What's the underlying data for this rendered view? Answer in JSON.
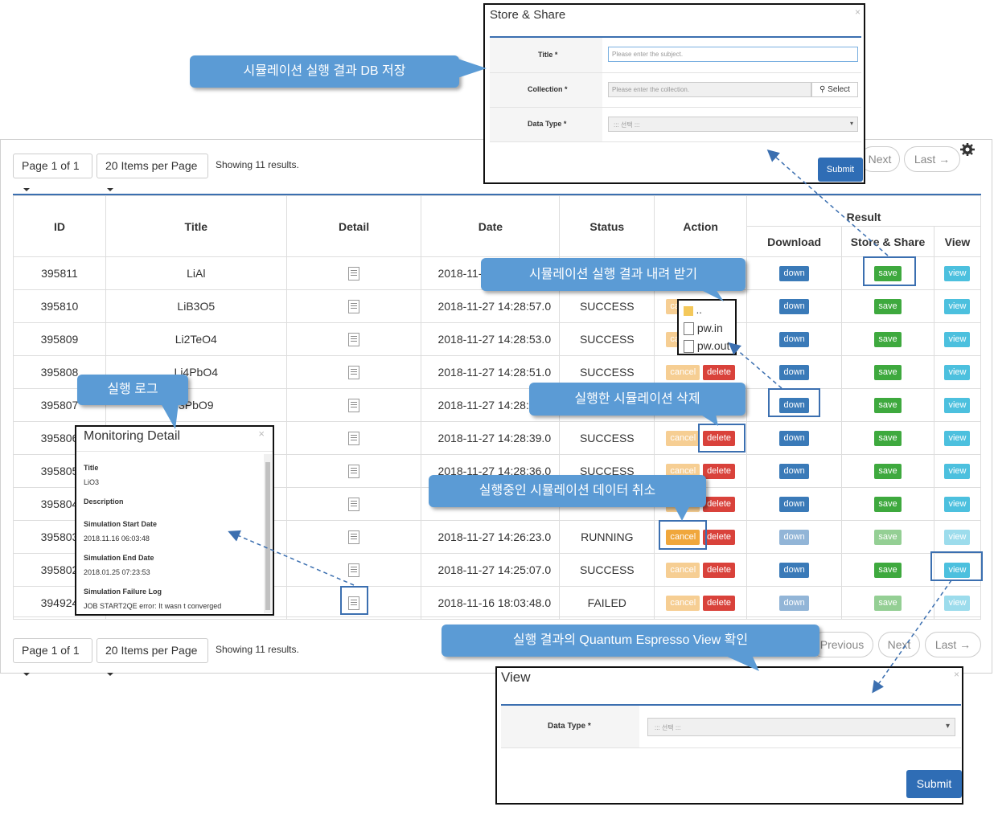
{
  "callouts": {
    "db_store": "시뮬레이션 실행 결과 DB 저장",
    "download": "시뮬레이션 실행 결과 내려 받기",
    "log": "실행 로그",
    "delete": "실행한 시뮬레이션 삭제",
    "cancel": "실행중인 시뮬레이션 데이터 취소",
    "view": "실행 결과의 Quantum Espresso View 확인"
  },
  "pager_top": {
    "page": "Page 1 of 1",
    "per_page": "20 Items per Page",
    "showing": "Showing 11 results.",
    "next": "Next",
    "last": "Last →"
  },
  "pager_bottom": {
    "page": "Page 1 of 1",
    "per_page": "20 Items per Page",
    "showing": "Showing 11 results.",
    "previous": "Previous",
    "next": "Next",
    "last": "Last →"
  },
  "table": {
    "headers": {
      "id": "ID",
      "title": "Title",
      "detail": "Detail",
      "date": "Date",
      "status": "Status",
      "action": "Action",
      "result": "Result",
      "download": "Download",
      "store_share": "Store & Share",
      "view": "View"
    },
    "button_labels": {
      "down": "down",
      "save": "save",
      "view": "view",
      "cancel": "cancel",
      "delete": "delete"
    },
    "rows": [
      {
        "id": "395811",
        "title": "LiAl",
        "date": "2018-11-",
        "status": ""
      },
      {
        "id": "395810",
        "title": "LiB3O5",
        "date": "2018-11-27 14:28:57.0",
        "status": "SUCCESS"
      },
      {
        "id": "395809",
        "title": "Li2TeO4",
        "date": "2018-11-27 14:28:53.0",
        "status": "SUCCESS"
      },
      {
        "id": "395808",
        "title": "Li4PbO4",
        "date": "2018-11-27 14:28:51.0",
        "status": "SUCCESS"
      },
      {
        "id": "395807",
        "title": "3PbO9",
        "date": "2018-11-27 14:28:4",
        "status": ""
      },
      {
        "id": "395806",
        "title": "",
        "date": "2018-11-27 14:28:39.0",
        "status": "SUCCESS"
      },
      {
        "id": "395805",
        "title": "",
        "date": "2018-11-27 14:28:36.0",
        "status": "SUCCESS"
      },
      {
        "id": "395804",
        "title": "",
        "date": "",
        "status": ""
      },
      {
        "id": "395803",
        "title": "",
        "date": "2018-11-27 14:26:23.0",
        "status": "RUNNING"
      },
      {
        "id": "395802",
        "title": "",
        "date": "2018-11-27 14:25:07.0",
        "status": "SUCCESS"
      },
      {
        "id": "394924",
        "title": "",
        "date": "2018-11-16 18:03:48.0",
        "status": "FAILED"
      }
    ]
  },
  "file_popup": {
    "items": [
      "..",
      "pw.in",
      "pw.out"
    ]
  },
  "store_modal": {
    "title": "Store & Share",
    "close": "×",
    "title_label": "Title *",
    "title_placeholder": "Please enter the subject.",
    "collection_label": "Collection *",
    "collection_placeholder": "Please enter the collection.",
    "select_label": "Select",
    "datatype_label": "Data Type *",
    "datatype_value": "::: 선택 :::",
    "submit": "Submit"
  },
  "monitor_modal": {
    "title": "Monitoring Detail",
    "close": "×",
    "title_label": "Title",
    "title_value": "LiO3",
    "description_label": "Description",
    "start_label": "Simulation Start Date",
    "start_value": "2018.11.16 06:03:48",
    "end_label": "Simulation End Date",
    "end_value": "2018.01.25 07:23:53",
    "failure_label": "Simulation Failure Log",
    "failure_value": "JOB START2QE error: It wasn t converged"
  },
  "view_modal": {
    "title": "View",
    "close": "×",
    "datatype_label": "Data Type *",
    "datatype_value": "::: 선택 :::",
    "submit": "Submit"
  },
  "colors": {
    "accent": "#3b6fb0",
    "callout": "#5b9bd5",
    "down": "#3a7ab8",
    "save": "#3ea93e",
    "view": "#4cc0de",
    "cancel": "#f0a73c",
    "delete": "#d9423b"
  }
}
